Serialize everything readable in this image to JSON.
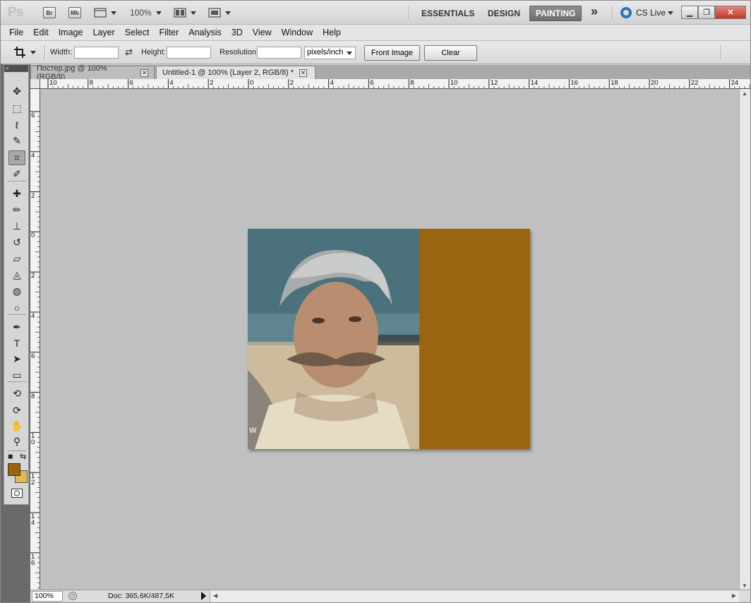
{
  "appbar": {
    "logo": "Ps",
    "bridge_label": "Br",
    "minibridge_label": "Mb",
    "zoom": "100%",
    "workspaces": [
      "ESSENTIALS",
      "DESIGN",
      "PAINTING"
    ],
    "active_workspace": "PAINTING",
    "more_glyph": "»",
    "cs_live": "CS Live"
  },
  "menu": [
    "File",
    "Edit",
    "Image",
    "Layer",
    "Select",
    "Filter",
    "Analysis",
    "3D",
    "View",
    "Window",
    "Help"
  ],
  "options": {
    "width_label": "Width:",
    "width_value": "",
    "height_label": "Height:",
    "height_value": "",
    "resolution_label": "Resolution:",
    "resolution_value": "",
    "units": "pixels/inch",
    "front_image": "Front Image",
    "clear": "Clear"
  },
  "tabs": [
    {
      "label": "Постер.jpg @ 100% (RGB/8)",
      "active": false
    },
    {
      "label": "Untitled-1 @ 100% (Layer 2, RGB/8) *",
      "active": true
    }
  ],
  "ruler_h": [
    "10",
    "8",
    "6",
    "4",
    "2",
    "0",
    "2",
    "4",
    "6",
    "8",
    "10",
    "12",
    "14",
    "16",
    "18",
    "20",
    "22",
    "24"
  ],
  "ruler_v": [
    "6",
    "4",
    "2",
    "0",
    "2",
    "4",
    "6",
    "8",
    "10",
    "12",
    "14",
    "16"
  ],
  "tools": [
    {
      "icon": "move-icon",
      "glyph": "✥"
    },
    {
      "icon": "marquee-icon",
      "glyph": "⬚"
    },
    {
      "icon": "lasso-icon",
      "glyph": "ℓ"
    },
    {
      "icon": "quick-select-icon",
      "glyph": "✎"
    },
    {
      "icon": "crop-icon",
      "glyph": "⌗"
    },
    {
      "icon": "eyedropper-icon",
      "glyph": "✐"
    },
    {
      "icon": "healing-brush-icon",
      "glyph": "✚"
    },
    {
      "icon": "brush-icon",
      "glyph": "✏"
    },
    {
      "icon": "clone-stamp-icon",
      "glyph": "⊥"
    },
    {
      "icon": "history-brush-icon",
      "glyph": "↺"
    },
    {
      "icon": "eraser-icon",
      "glyph": "▱"
    },
    {
      "icon": "paint-bucket-icon",
      "glyph": "◬"
    },
    {
      "icon": "blur-icon",
      "glyph": "◍"
    },
    {
      "icon": "dodge-icon",
      "glyph": "○"
    },
    {
      "icon": "pen-icon",
      "glyph": "✒"
    },
    {
      "icon": "type-icon",
      "glyph": "T"
    },
    {
      "icon": "path-select-icon",
      "glyph": "➤"
    },
    {
      "icon": "shape-icon",
      "glyph": "▭"
    },
    {
      "icon": "3d-rotate-icon",
      "glyph": "⟲"
    },
    {
      "icon": "3d-orbit-icon",
      "glyph": "⟳"
    },
    {
      "icon": "hand-icon",
      "glyph": "✋"
    },
    {
      "icon": "zoom-icon",
      "glyph": "⚲"
    }
  ],
  "colors": {
    "foreground": "#9a6410",
    "background": "#e0b850",
    "fill_rect": "#9a6410",
    "canvas_bg": "#c0c0c0"
  },
  "canvas": {
    "watermark": "W"
  },
  "status": {
    "zoom": "100%",
    "doc": "Doc: 365,6K/487,5K"
  }
}
